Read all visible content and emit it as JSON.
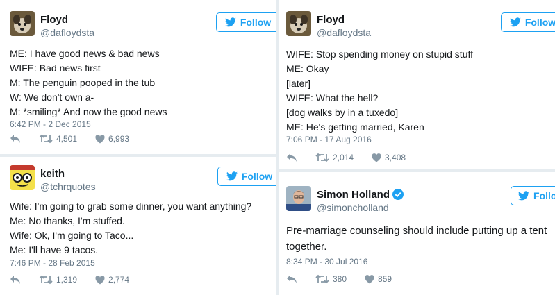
{
  "follow_label": "Follow",
  "tweets": [
    {
      "name": "Floyd",
      "handle": "@dafloydsta",
      "lines": [
        "ME: I have good news & bad news",
        "WIFE: Bad news first",
        "M: The penguin pooped in the tub",
        "W: We don't own a-",
        "M: *smiling* And now the good news"
      ],
      "timestamp": "6:42 PM - 2 Dec 2015",
      "retweets": "4,501",
      "likes": "6,993"
    },
    {
      "name": "keith",
      "handle": "@tchrquotes",
      "lines": [
        "Wife: I'm going to grab some dinner, you want anything?",
        "Me: No thanks, I'm stuffed.",
        "Wife: Ok, I'm going to Taco...",
        "Me: I'll have 9 tacos."
      ],
      "timestamp": "7:46 PM - 28 Feb 2015",
      "retweets": "1,319",
      "likes": "2,774"
    },
    {
      "name": "Floyd",
      "handle": "@dafloydsta",
      "lines": [
        "WIFE: Stop spending money on stupid stuff",
        "ME: Okay",
        "[later]",
        "WIFE: What the hell?",
        "[dog walks by in a tuxedo]",
        "ME: He's getting married, Karen"
      ],
      "timestamp": "7:06 PM - 17 Aug 2016",
      "retweets": "2,014",
      "likes": "3,408"
    },
    {
      "name": "Simon Holland",
      "handle": "@simoncholland",
      "verified": true,
      "lines": [
        "Pre-marriage counseling should include putting up a tent",
        "together."
      ],
      "timestamp": "8:34 PM - 30 Jul 2016",
      "retweets": "380",
      "likes": "859"
    }
  ],
  "colors": {
    "brand_blue": "#1da1f2",
    "text_primary": "#14171a",
    "text_secondary": "#657786",
    "background": "#e6ecf0"
  },
  "icons": {
    "follow": "twitter-bird-icon",
    "reply": "reply-arrow-icon",
    "retweet": "retweet-icon",
    "like": "heart-icon",
    "verified": "verified-badge-icon"
  }
}
